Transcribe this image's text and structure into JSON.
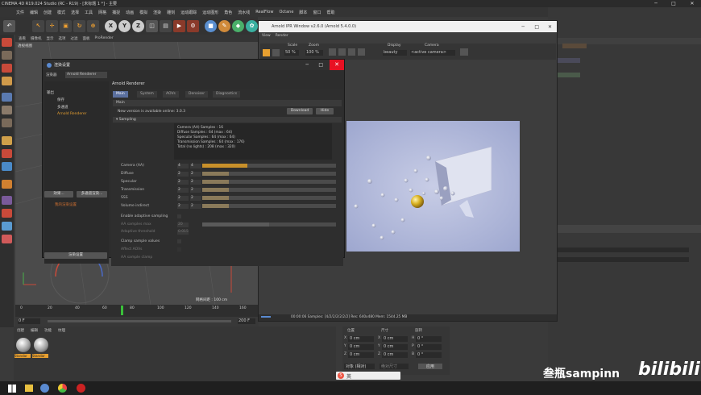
{
  "window": {
    "title": "CINEMA 4D R19.024 Studio (RC - R19) - [未标题 1 *] - 主要",
    "min": "─",
    "max": "□",
    "close": "✕"
  },
  "menubar": [
    "文件",
    "编辑",
    "创建",
    "模式",
    "选择",
    "工具",
    "网格",
    "捕捉",
    "动画",
    "模拟",
    "渲染",
    "雕刻",
    "运动跟踪",
    "运动图形",
    "角色",
    "流水线",
    "RealFlow",
    "Octane",
    "脚本",
    "窗口",
    "帮助"
  ],
  "layout": {
    "label": "界面",
    "value": "启动 (用户)"
  },
  "viewport": {
    "menu": [
      "查看",
      "摄像机",
      "显示",
      "选项",
      "过滤",
      "面板",
      "ProRender"
    ],
    "label": "透视视图",
    "grid": "网格间距 : 100 cm"
  },
  "timeline": {
    "ticks": [
      "0",
      "20",
      "40",
      "60",
      "80",
      "100",
      "120",
      "140",
      "160"
    ],
    "frame_start": "0 F",
    "frame_end": "200 F",
    "marker": "0 F"
  },
  "materials": {
    "menu": [
      "创建",
      "编辑",
      "功能",
      "纹理"
    ],
    "items": [
      "Standar",
      "Standar"
    ]
  },
  "coords": {
    "headers": [
      "位置",
      "尺寸",
      "旋转"
    ],
    "rows": [
      [
        "X",
        "0 cm",
        "X",
        "0 cm",
        "H",
        "0 °"
      ],
      [
        "Y",
        "0 cm",
        "Y",
        "0 cm",
        "P",
        "0 °"
      ],
      [
        "Z",
        "0 cm",
        "Z",
        "0 cm",
        "B",
        "0 °"
      ]
    ],
    "mode": "对象 (相对)",
    "size_mode": "绝对尺寸",
    "apply": "应用"
  },
  "render_settings": {
    "title": "渲染设置",
    "renderer_label": "渲染器",
    "renderer_value": "Arnold Renderer",
    "left_items": [
      "输出",
      "保存",
      "多通道",
      "Arnold Renderer"
    ],
    "effects_btn": "效果...",
    "multipass_btn": "多通道渲染...",
    "preset": "我的渲染设置",
    "render_btn": "渲染设置",
    "panel_title": "Arnold Renderer",
    "tabs": [
      "Main",
      "System",
      "AOVs",
      "Denoiser",
      "Diagnostics"
    ],
    "main_header": "Main",
    "update_text": "New version is available online: 3.0.3",
    "download": "Download",
    "hide": "Hide",
    "sampling": "▾ Sampling",
    "info": [
      "Camera (AA) Samples : 16",
      "Diffuse Samples : 64 (max : 64)",
      "Specular Samples : 64 (max : 64)",
      "Transmission Samples : 64 (max : 176)",
      "Total (no lights) : 208 (max : 320)"
    ],
    "samples": [
      {
        "label": "Camera (AA)",
        "v": "4",
        "v2": "4",
        "fill": 0.34
      },
      {
        "label": "Diffuse",
        "v": "2",
        "v2": "2",
        "fill": 0.2
      },
      {
        "label": "Specular",
        "v": "2",
        "v2": "2",
        "fill": 0.2
      },
      {
        "label": "Transmission",
        "v": "2",
        "v2": "2",
        "fill": 0.2
      },
      {
        "label": "SSS",
        "v": "2",
        "v2": "2",
        "fill": 0.2
      },
      {
        "label": "Volume indirect",
        "v": "2",
        "v2": "2",
        "fill": 0.2
      }
    ],
    "adaptive": "Enable adaptive sampling",
    "aa_max": "AA samples max",
    "aa_max_v": "20",
    "threshold": "Adaptive threshold",
    "threshold_v": "0.015",
    "clamp": "Clamp sample values",
    "affect_aovs": "Affect AOVs",
    "aa_clamp": "AA sample clamp"
  },
  "ipr": {
    "title": "Arnold IPR Window v2.6.0 (Arnold 5.4.0.0)",
    "menu": [
      "View",
      "Render"
    ],
    "scale_label": "Scale",
    "scale": "50 %",
    "zoom_label": "Zoom",
    "zoom": "100 %",
    "display_label": "Display",
    "display": "beauty",
    "camera_label": "Camera",
    "camera": "<active camera>",
    "status": "00:00:06  Samples: [4/2/2/2/2/2/2]  Res: 640x480  Mem: 1544.25 MB",
    "min": "─",
    "max": "□",
    "close": "✕"
  },
  "watermark": "叁瓶sampinn",
  "brand": "bilibili",
  "input_btn": "英"
}
